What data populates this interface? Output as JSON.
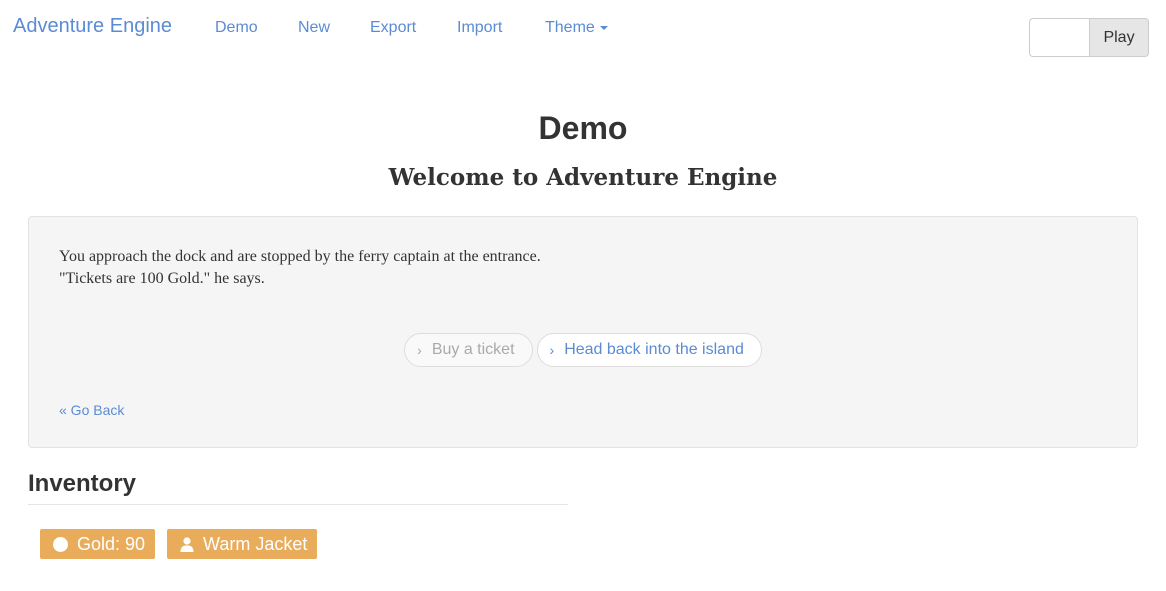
{
  "navbar": {
    "brand": "Adventure Engine",
    "links": [
      "Demo",
      "New",
      "Export",
      "Import"
    ],
    "theme_label": "Theme",
    "play_input_value": "",
    "play_label": "Play"
  },
  "page": {
    "title": "Demo",
    "subtitle": "Welcome to Adventure Engine"
  },
  "scene": {
    "line1": "You approach the dock and are stopped by the ferry captain at the entrance.",
    "line2": "\"Tickets are 100 Gold.\" he says.",
    "choices": [
      {
        "label": "Buy a ticket",
        "state": "disabled"
      },
      {
        "label": "Head back into the island",
        "state": "enabled"
      }
    ],
    "go_back": "« Go Back"
  },
  "inventory": {
    "title": "Inventory",
    "items": [
      {
        "label": "Gold: 90",
        "icon": "circle-icon"
      },
      {
        "label": "Warm Jacket",
        "icon": "user-icon"
      }
    ]
  },
  "colors": {
    "link": "#5b8bd4",
    "badge": "#e9ac5b",
    "well": "#f5f5f5"
  }
}
